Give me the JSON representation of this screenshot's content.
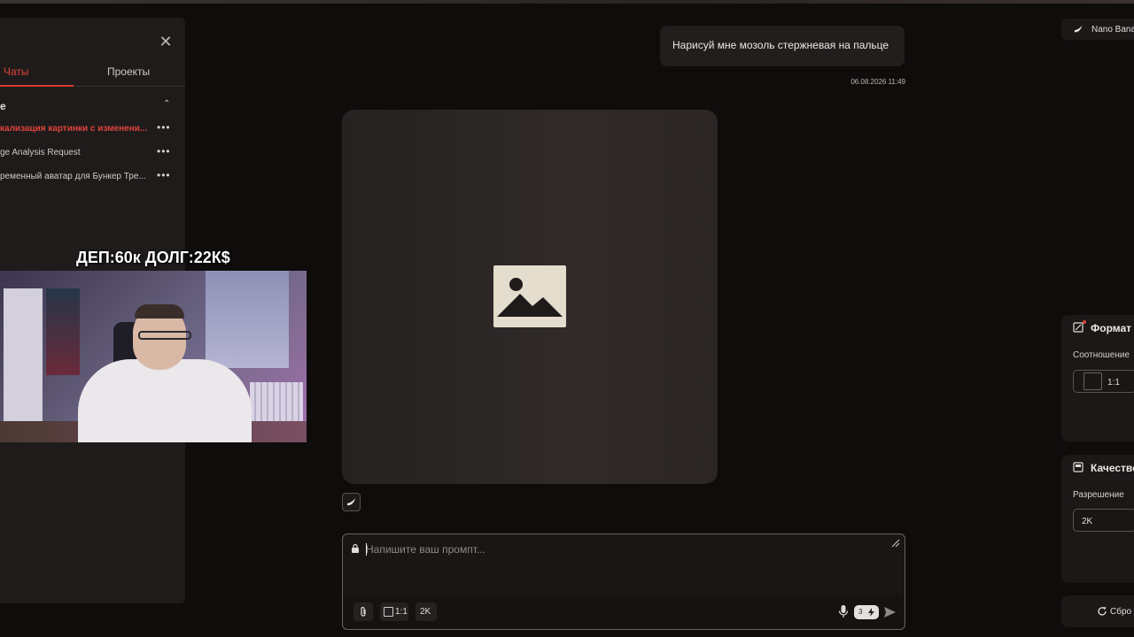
{
  "sidebar": {
    "tabs": [
      {
        "label": "Чаты",
        "active": true
      },
      {
        "label": "Проекты",
        "active": false
      }
    ],
    "section_title": "е",
    "items": [
      {
        "label": "кализация картинки с изменени...",
        "active": true
      },
      {
        "label": "ge Analysis Request",
        "active": false
      },
      {
        "label": "ременный аватар для Бункер Тре...",
        "active": false
      }
    ]
  },
  "overlay": {
    "text": "ДЕП:60к ДОЛГ:22К$"
  },
  "chat": {
    "user_message": "Нарисуй мне мозоль стержневая на пальце",
    "timestamp": "06.08.2026 11:49"
  },
  "prompt": {
    "placeholder": "Напишите ваш промпт...",
    "ratio": "1:1",
    "quality": "2K",
    "credits": "3"
  },
  "right_panel": {
    "model_name": "Nano Bana",
    "format_title": "Формат",
    "aspect_label": "Соотношение",
    "aspect_value": "1:1",
    "quality_title": "Качество",
    "resolution_label": "Разрешение",
    "resolution_value": "2K",
    "reset_label": "Сбро"
  },
  "colors": {
    "accent": "#e0443a",
    "background": "#0f0c0c",
    "panel": "#1f1b1b"
  }
}
